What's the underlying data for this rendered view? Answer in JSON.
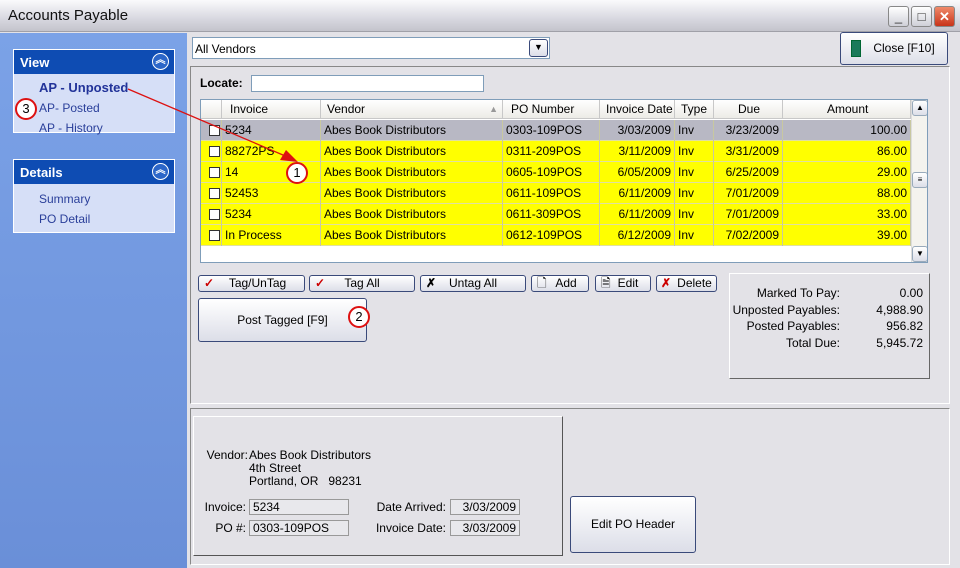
{
  "window": {
    "title": "Accounts Payable",
    "controls": [
      "minimize",
      "maximize",
      "close"
    ]
  },
  "sidebar": {
    "view": {
      "title": "View",
      "items": [
        {
          "label": "AP - Unposted",
          "active": true
        },
        {
          "label": "AP- Posted"
        },
        {
          "label": "AP - History"
        }
      ]
    },
    "details": {
      "title": "Details",
      "items": [
        {
          "label": "Summary"
        },
        {
          "label": "PO Detail"
        }
      ]
    }
  },
  "toolbar": {
    "vendor_filter": "All Vendors",
    "close_label": "Close [F10]"
  },
  "locate": {
    "label": "Locate:",
    "value": ""
  },
  "grid": {
    "columns": [
      "Invoice",
      "Vendor",
      "PO Number",
      "Invoice Date",
      "Type",
      "Due",
      "Amount"
    ],
    "sort_column": "Vendor",
    "row_highlight_color": "#ffff00",
    "rows": [
      {
        "tagged": false,
        "selected": true,
        "invoice": "5234",
        "vendor": "Abes Book Distributors",
        "po": "0303-109POS",
        "date": "3/03/2009",
        "type": "Inv",
        "due": "3/23/2009",
        "amount": "100.00"
      },
      {
        "tagged": false,
        "invoice": "88272PS",
        "vendor": "Abes Book Distributors",
        "po": "0311-209POS",
        "date": "3/11/2009",
        "type": "Inv",
        "due": "3/31/2009",
        "amount": "86.00"
      },
      {
        "tagged": false,
        "invoice": "14",
        "vendor": "Abes Book Distributors",
        "po": "0605-109POS",
        "date": "6/05/2009",
        "type": "Inv",
        "due": "6/25/2009",
        "amount": "29.00"
      },
      {
        "tagged": false,
        "invoice": "52453",
        "vendor": "Abes Book Distributors",
        "po": "0611-109POS",
        "date": "6/11/2009",
        "type": "Inv",
        "due": "7/01/2009",
        "amount": "88.00"
      },
      {
        "tagged": false,
        "invoice": "5234",
        "vendor": "Abes Book Distributors",
        "po": "0611-309POS",
        "date": "6/11/2009",
        "type": "Inv",
        "due": "7/01/2009",
        "amount": "33.00"
      },
      {
        "tagged": false,
        "invoice": "In Process",
        "vendor": "Abes Book Distributors",
        "po": "0612-109POS",
        "date": "6/12/2009",
        "type": "Inv",
        "due": "7/02/2009",
        "amount": "39.00"
      }
    ]
  },
  "actions": {
    "tag_untag": "Tag/UnTag",
    "tag_all": "Tag All",
    "untag_all": "Untag All",
    "add": "Add",
    "edit": "Edit",
    "delete": "Delete",
    "post_tagged": "Post Tagged [F9]"
  },
  "totals": [
    {
      "label": "Marked To Pay:",
      "value": "0.00"
    },
    {
      "label": "Unposted Payables:",
      "value": "4,988.90"
    },
    {
      "label": "Posted Payables:",
      "value": "956.82"
    },
    {
      "label": "Total Due:",
      "value": "5,945.72"
    }
  ],
  "detail": {
    "vendor_label": "Vendor:",
    "vendor_name": "Abes Book Distributors",
    "address1": "4th Street",
    "address2": "Portland, OR   98231",
    "invoice_label": "Invoice:",
    "invoice": "5234",
    "po_label": "PO #:",
    "po": "0303-109POS",
    "date_arrived_label": "Date Arrived:",
    "date_arrived": "3/03/2009",
    "invoice_date_label": "Invoice Date:",
    "invoice_date": "3/03/2009",
    "edit_po_header": "Edit PO Header"
  },
  "annotations": {
    "one": "1",
    "two": "2",
    "three": "3",
    "color": "#dd1111"
  }
}
